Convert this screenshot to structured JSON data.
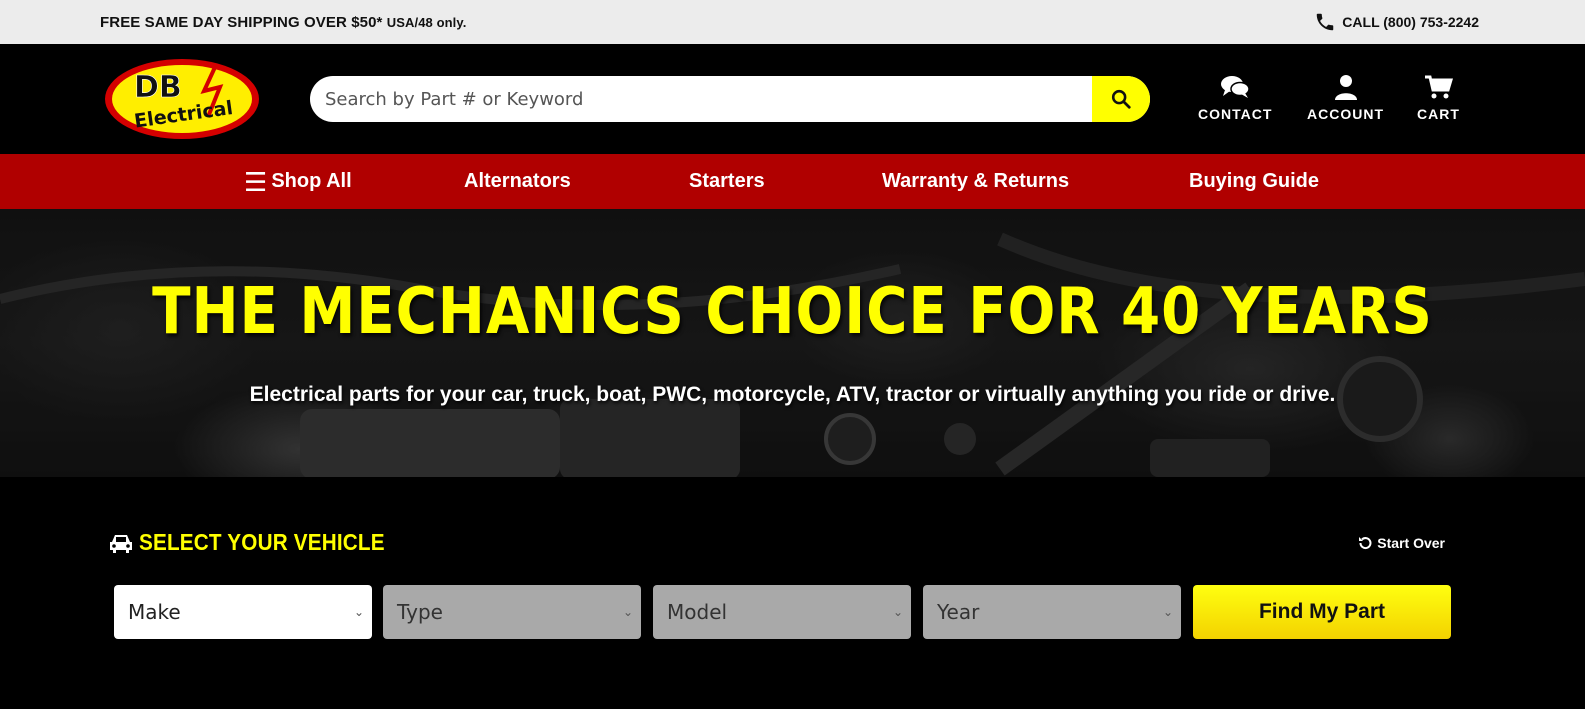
{
  "topbar": {
    "promo_main": "FREE SAME DAY SHIPPING OVER $50*",
    "promo_note": "USA/48 only.",
    "phone": "CALL (800) 753-2242"
  },
  "header": {
    "logo_top": "DB",
    "logo_bottom": "Electrical",
    "search_placeholder": "Search by Part # or Keyword",
    "nav": [
      {
        "label": "CONTACT",
        "icon": "chat-icon"
      },
      {
        "label": "ACCOUNT",
        "icon": "user-icon"
      },
      {
        "label": "CART",
        "icon": "cart-icon"
      }
    ]
  },
  "mainnav": {
    "items": [
      {
        "label": "Shop All"
      },
      {
        "label": "Alternators"
      },
      {
        "label": "Starters"
      },
      {
        "label": "Warranty & Returns"
      },
      {
        "label": "Buying Guide"
      }
    ]
  },
  "hero": {
    "headline": "THE MECHANICS CHOICE FOR 40 YEARS",
    "subline": "Electrical parts for your car, truck, boat, PWC, motorcycle, ATV, tractor or virtually anything you ride or drive."
  },
  "vehicle": {
    "title": "SELECT YOUR VEHICLE",
    "start_over": "Start Over",
    "selects": [
      "Make",
      "Type",
      "Model",
      "Year"
    ],
    "find_button": "Find My Part"
  },
  "colors": {
    "accent_yellow": "#ffff00",
    "nav_red": "#b00000",
    "topbar_bg": "#ececec"
  }
}
